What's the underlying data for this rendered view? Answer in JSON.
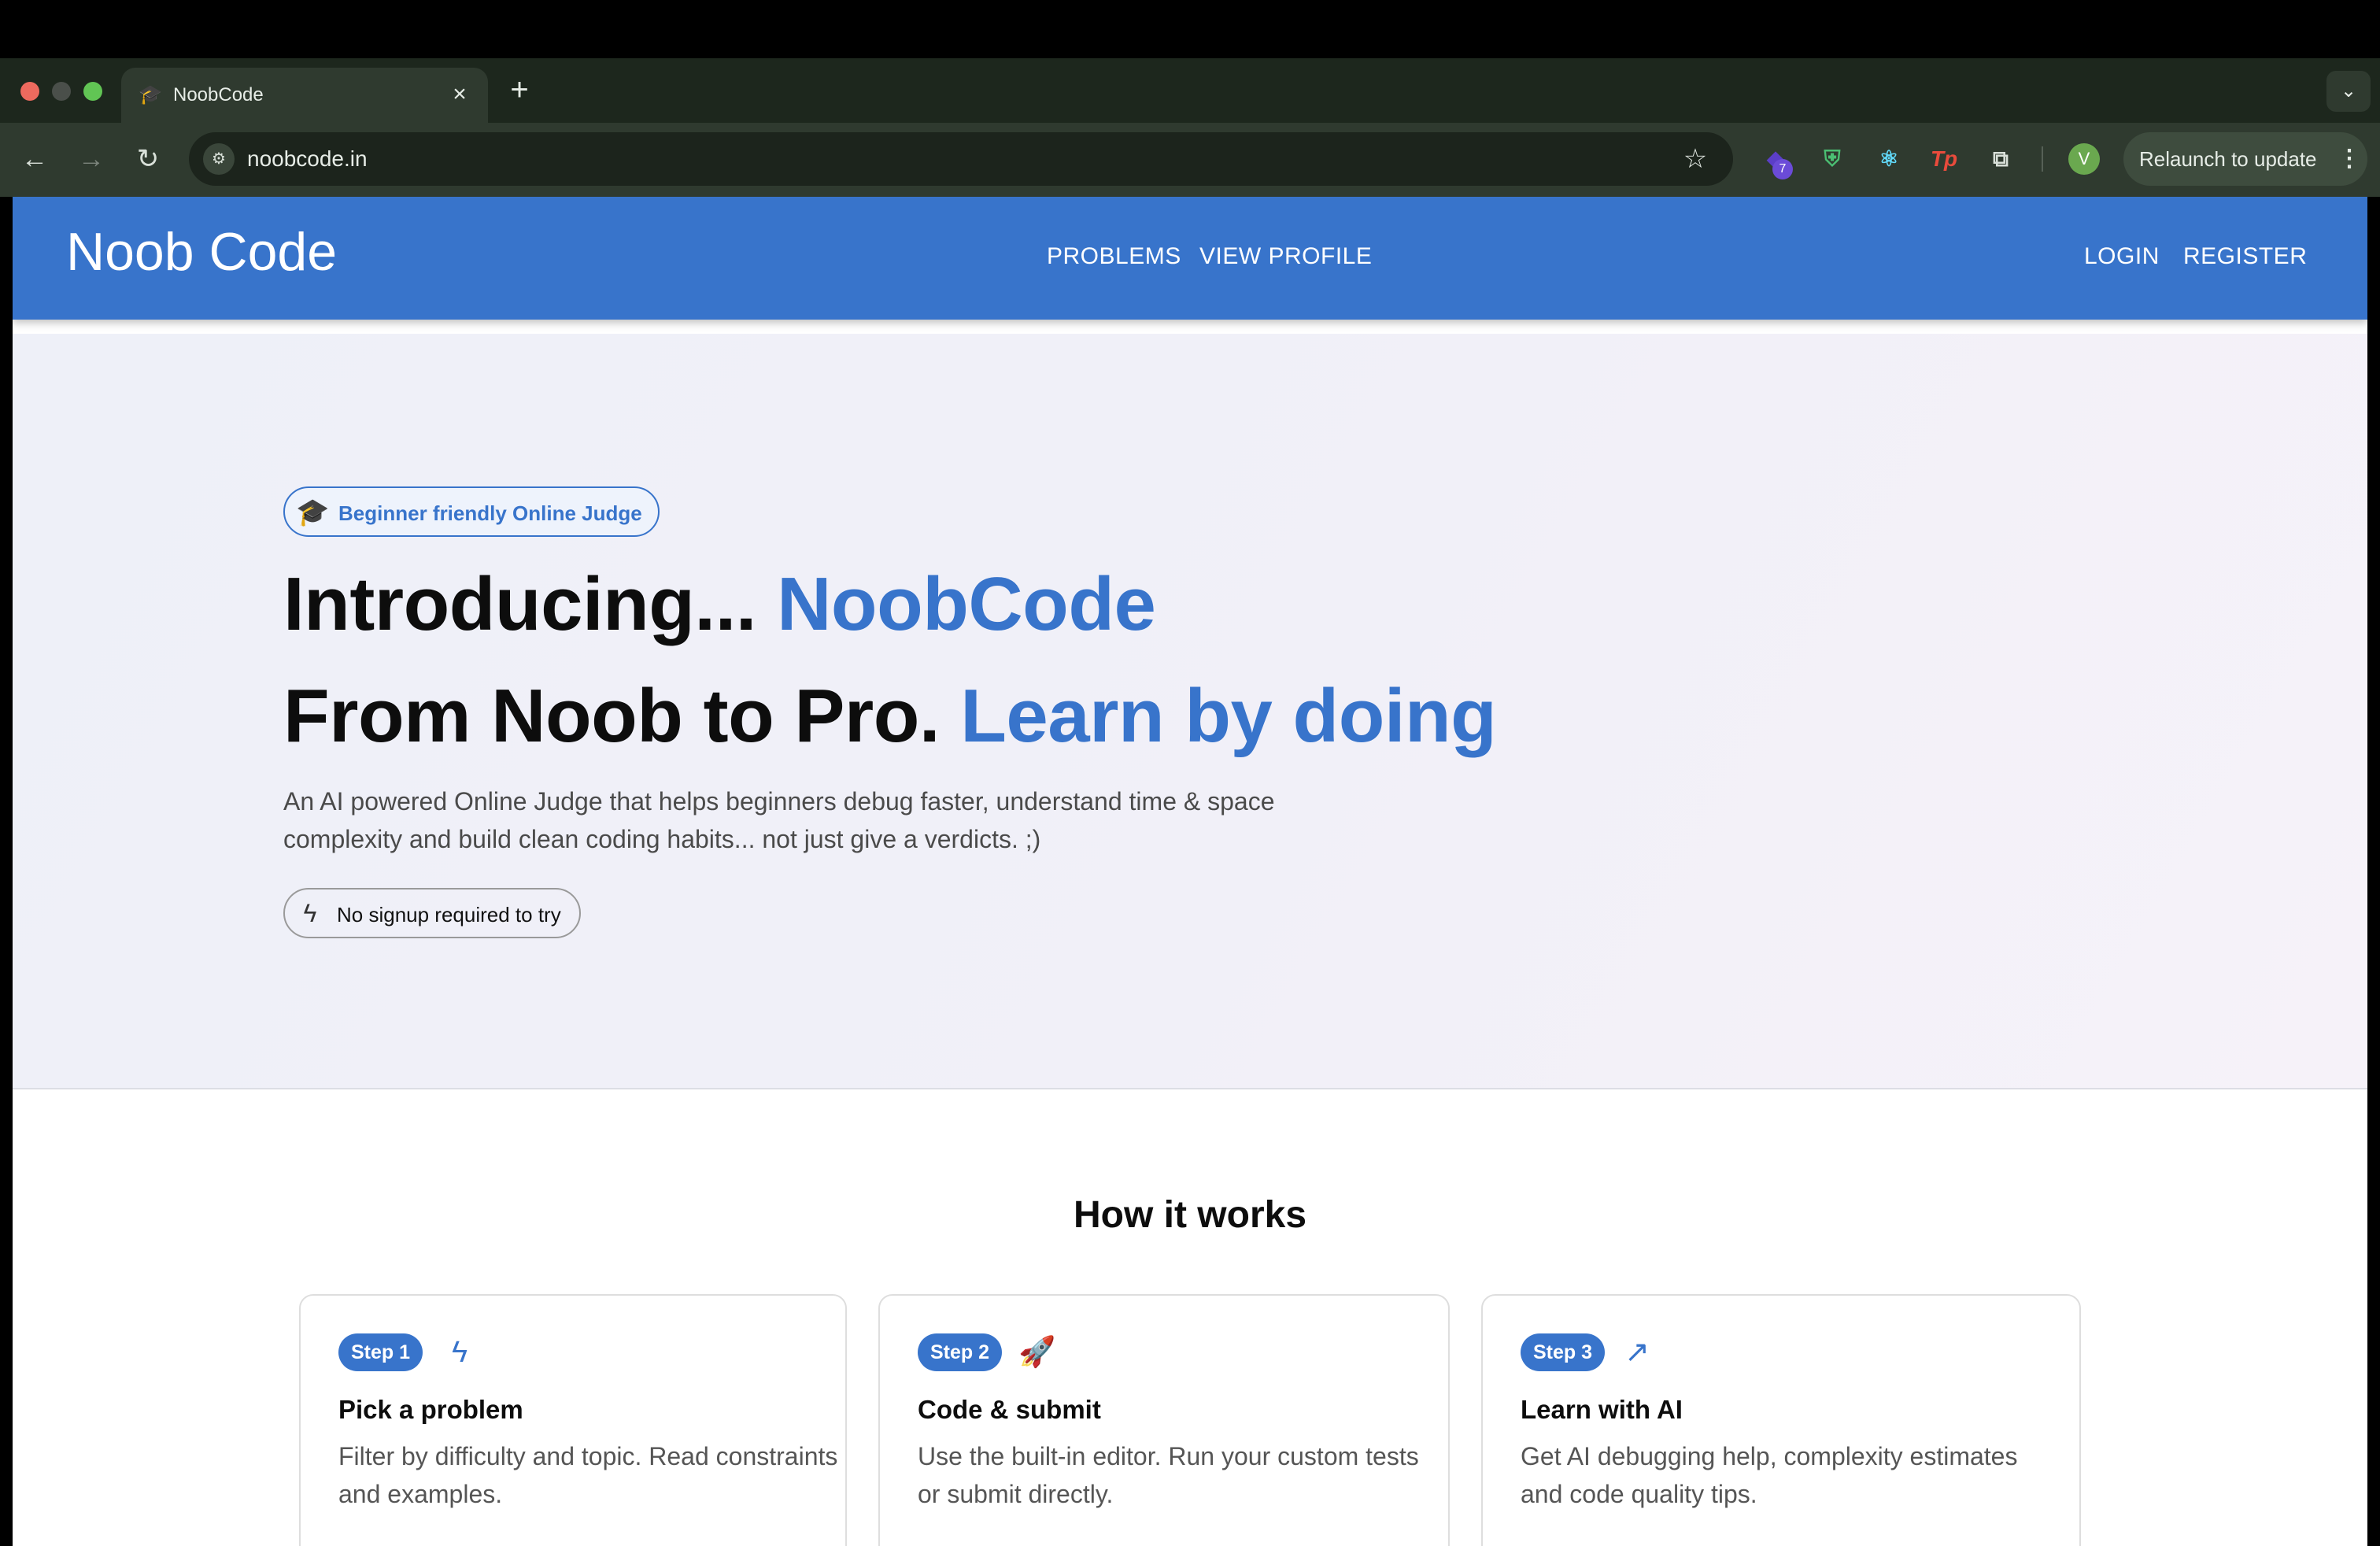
{
  "browser": {
    "tab": {
      "title": "NoobCode",
      "favicon": "mortarboard-icon"
    },
    "new_tab_label": "+",
    "address": {
      "url": "noobcode.in"
    },
    "extensions": {
      "badge_count": "7"
    },
    "profile": {
      "initial": "V"
    },
    "relaunch_label": "Relaunch to update"
  },
  "app": {
    "brand": "Noob Code",
    "nav": {
      "problems": "PROBLEMS",
      "view_profile": "VIEW PROFILE",
      "login": "LOGIN",
      "register": "REGISTER"
    }
  },
  "hero": {
    "chip_label": "Beginner friendly Online Judge",
    "headline1": {
      "prefix": "Introducing... ",
      "accent": "NoobCode"
    },
    "headline2": {
      "prefix": "From Noob to Pro. ",
      "accent": "Learn by doing"
    },
    "tagline": "An AI powered Online Judge that helps beginners debug faster, understand time & space complexity and build clean coding habits... not just give a verdicts. ;)",
    "pill_label": "No signup required to try"
  },
  "how_it_works": {
    "title": "How it works",
    "steps": [
      {
        "badge": "Step 1",
        "icon": "bolt-icon",
        "title": "Pick a problem",
        "desc": "Filter by difficulty and topic. Read constraints and examples."
      },
      {
        "badge": "Step 2",
        "icon": "rocket-icon",
        "title": "Code & submit",
        "desc": "Use the built-in editor. Run your custom tests or submit directly."
      },
      {
        "badge": "Step 3",
        "icon": "trending-icon",
        "title": "Learn with AI",
        "desc": "Get AI debugging help, complexity estimates and code quality tips."
      }
    ]
  },
  "colors": {
    "primary": "#3874cb",
    "hero_bg": "#eef0f8",
    "chrome_bg": "#2f3a2f"
  }
}
